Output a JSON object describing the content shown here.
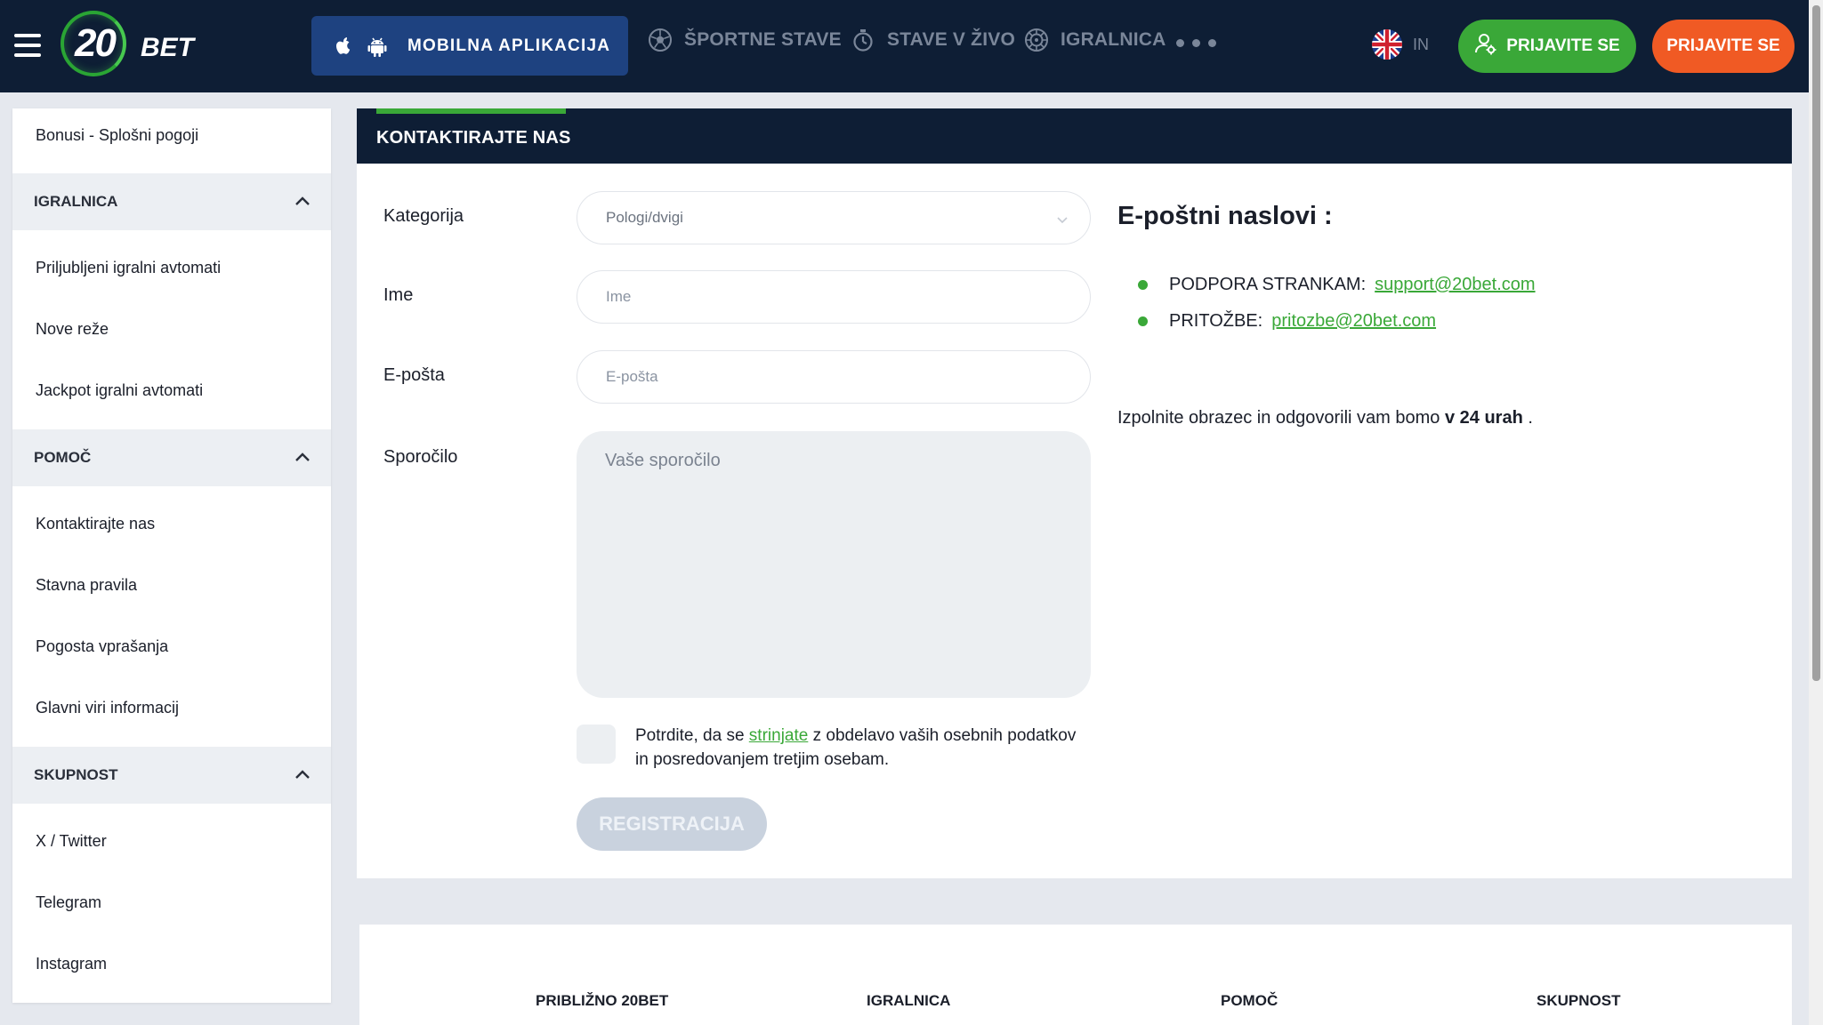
{
  "header": {
    "logo_number": "20",
    "logo_text": "BET",
    "app_button": "MOBILNA APLIKACIJA",
    "nav": [
      "ŠPORTNE STAVE",
      "STAVE V ŽIVO",
      "IGRALNICA"
    ],
    "language": "IN",
    "login": "PRIJAVITE SE",
    "register": "PRIJAVITE SE",
    "colors": {
      "bg": "#0e1e35",
      "login": "#3aa838",
      "register": "#f05a24"
    }
  },
  "sidebar": {
    "top_item": "Bonusi - Splošni pogoji",
    "sections": [
      {
        "title": "IGRALNICA",
        "items": [
          "Priljubljeni igralni avtomati",
          "Nove reže",
          "Jackpot igralni avtomati"
        ]
      },
      {
        "title": "POMOČ",
        "items": [
          "Kontaktirajte nas",
          "Stavna pravila",
          "Pogosta vprašanja",
          "Glavni viri informacij"
        ]
      },
      {
        "title": "SKUPNOST",
        "items": [
          "X / Twitter",
          "Telegram",
          "Instagram"
        ]
      }
    ]
  },
  "main": {
    "title": "KONTAKTIRAJTE NAS",
    "form": {
      "category_label": "Kategorija",
      "category_value": "Pologi/dvigi",
      "name_label": "Ime",
      "name_placeholder": "Ime",
      "email_label": "E-pošta",
      "email_placeholder": "E-pošta",
      "message_label": "Sporočilo",
      "message_placeholder": "Vaše sporočilo",
      "consent_before": "Potrdite, da se ",
      "consent_link": "strinjate",
      "consent_after": " z obdelavo vaših osebnih podatkov in posredovanjem tretjim osebam.",
      "submit": "REGISTRACIJA"
    },
    "emails": {
      "title": "E-poštni naslovi :",
      "rows": [
        {
          "label": "PODPORA STRANKAM:",
          "email": "support@20bet.com"
        },
        {
          "label": "PRITOŽBE:",
          "email": "pritozbe@20bet.com"
        }
      ],
      "respond_before": "Izpolnite obrazec in odgovorili vam bomo ",
      "respond_bold": "v 24 urah",
      "respond_after": " ."
    }
  },
  "footer": {
    "columns": [
      "PRIBLIŽNO 20BET",
      "IGRALNICA",
      "POMOČ",
      "SKUPNOST"
    ]
  }
}
